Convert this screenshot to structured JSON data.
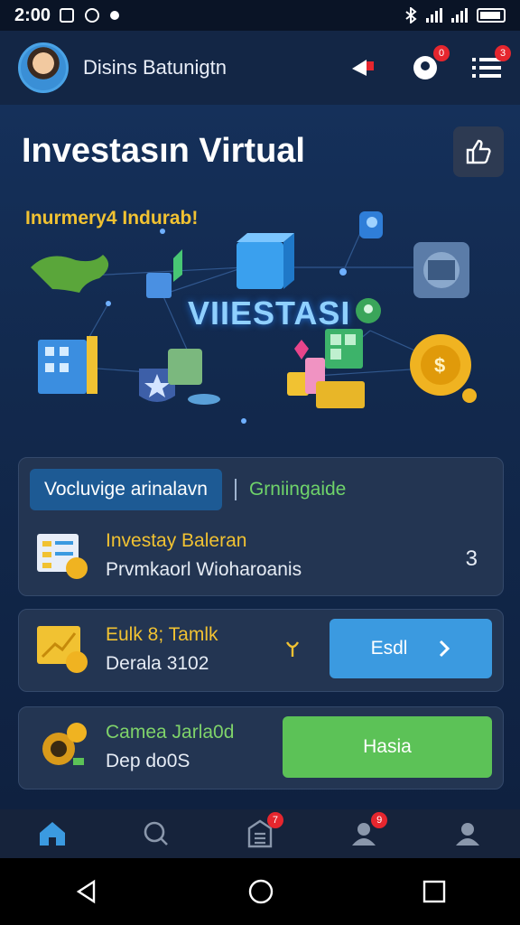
{
  "status_bar": {
    "time": "2:00"
  },
  "header": {
    "username": "Disins Batunigtn",
    "badges": {
      "alerts": "0",
      "menu": "3"
    }
  },
  "page": {
    "title": "Investasın Virtual"
  },
  "hero": {
    "caption": "Inurmery4 Indurab!",
    "center_label": "VIIESTASI"
  },
  "card1": {
    "tab_active": "Vocluvige arinalavn",
    "tab_other": "Grniingaide",
    "item_title": "Investay Baleran",
    "item_sub": "Prvmkaorl Wioharoanis",
    "item_value": "3"
  },
  "card2": {
    "title": "Eulk 8; Tamlk",
    "sub": "Derala 3102",
    "button_label": "Esdl"
  },
  "card3": {
    "title": "Camea Jarla0d",
    "sub": "Dep do0S",
    "button_label": "Hasia"
  },
  "bottom_nav": {
    "badges": {
      "orders": "7",
      "notify": "9"
    }
  },
  "colors": {
    "accent_blue": "#3b9ae0",
    "accent_green": "#5cc257",
    "gold": "#f1c232",
    "badge_red": "#e6262e"
  }
}
